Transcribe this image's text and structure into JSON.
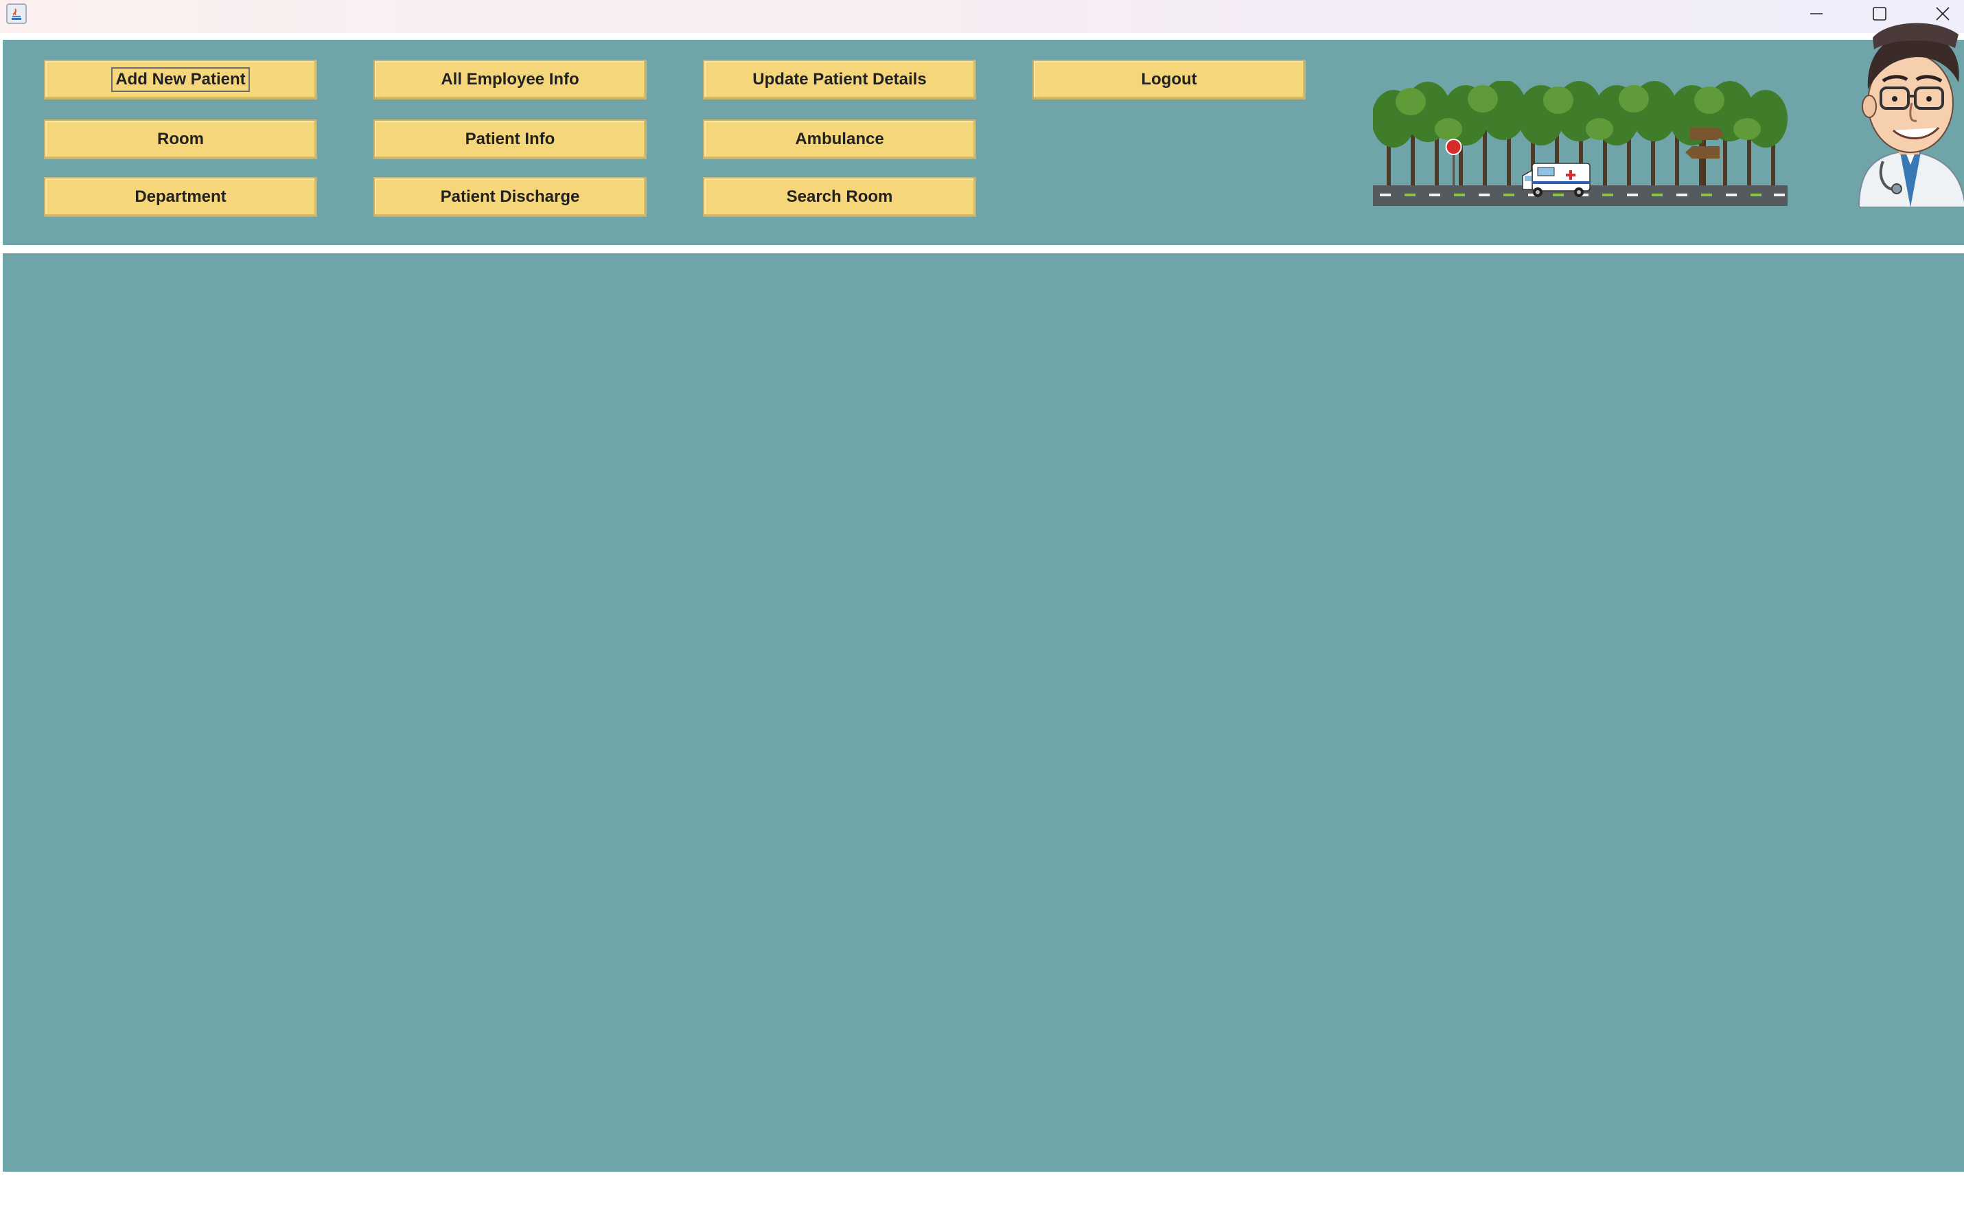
{
  "window": {
    "icons": {
      "app": "java-app-icon",
      "minimize": "minimize-icon",
      "maximize": "maximize-icon",
      "close": "close-icon"
    }
  },
  "menu": {
    "row1": [
      "Add New Patient",
      "All Employee Info",
      "Update Patient Details",
      "Logout"
    ],
    "row2": [
      "Room",
      "Patient Info",
      "Ambulance"
    ],
    "row3": [
      "Department",
      "Patient Discharge",
      "Search Room"
    ]
  },
  "colors": {
    "panel": "#6fa4a9",
    "button": "#f6d67a",
    "button_text": "#222222"
  }
}
